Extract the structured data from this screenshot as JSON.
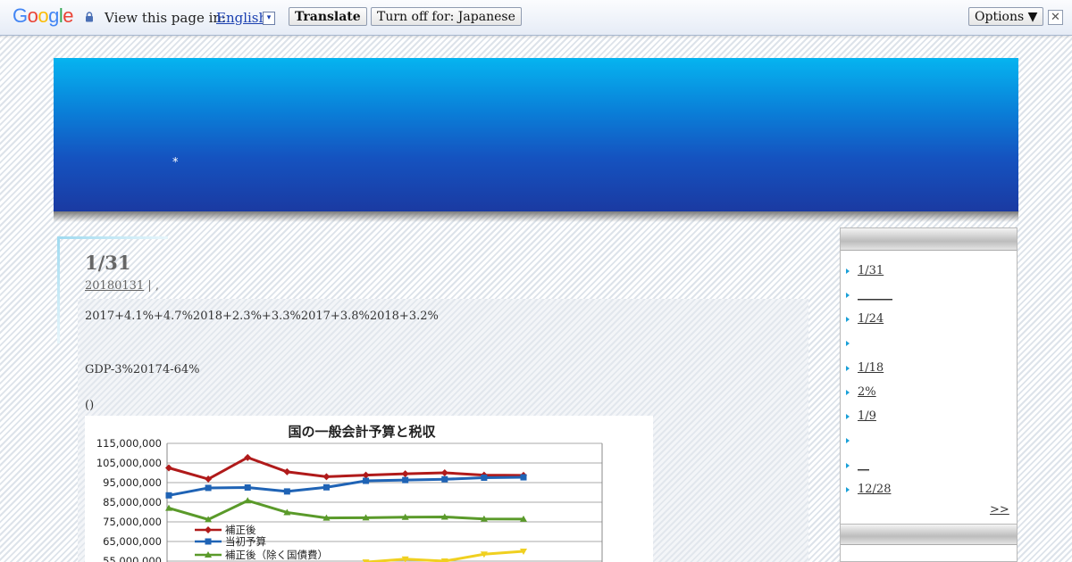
{
  "translate_bar": {
    "view_label": "View this page in:",
    "language": "English",
    "dropdown_glyph": "▾",
    "translate_label": "Translate",
    "turn_off_label": "Turn off for: Japanese",
    "options_label": "Options ▼",
    "close_glyph": "✕",
    "logo": [
      "G",
      "o",
      "o",
      "g",
      "l",
      "e"
    ],
    "logo_colors": [
      "#4285f4",
      "#ea4335",
      "#fbbc05",
      "#4285f4",
      "#34a853",
      "#ea4335"
    ]
  },
  "header": {
    "mark": "*"
  },
  "post": {
    "title": "1/31",
    "date_link": "20180131",
    "meta_suffix": " | ,",
    "paragraphs": [
      "2017+4.1%+4.7%2018+2.3%+3.3%2017+3.8%2018+3.2%",
      "GDP-3%20174-64%",
      "()"
    ]
  },
  "sidebar": {
    "items": [
      {
        "label": "1/31",
        "link": true
      },
      {
        "label": "______",
        "link": true
      },
      {
        "label": "1/24",
        "link": true
      },
      {
        "label": "",
        "link": false
      },
      {
        "label": "1/18",
        "link": true
      },
      {
        "label": "2%",
        "link": true
      },
      {
        "label": "1/9",
        "link": true
      },
      {
        "label": "",
        "link": false
      },
      {
        "label": "__",
        "link": true
      },
      {
        "label": "12/28",
        "link": true
      }
    ],
    "more": ">>",
    "second_widget_item": "(?)"
  },
  "chart_data": {
    "type": "line",
    "title": "国の一般会計予算と税収",
    "ylim": [
      55000000,
      115000000
    ],
    "yticks": [
      "115,000,000",
      "105,000,000",
      "95,000,000",
      "85,000,000",
      "75,000,000",
      "65,000,000",
      "55,000,000"
    ],
    "series": [
      {
        "name": "補正後",
        "color": "#b01a1a",
        "marker": "diamond",
        "values": [
          102500000,
          96800000,
          107800000,
          100500000,
          98000000,
          98800000,
          99500000,
          100000000,
          98800000,
          98700000
        ]
      },
      {
        "name": "当初予算",
        "color": "#1f63b5",
        "marker": "square",
        "values": [
          88500000,
          92300000,
          92500000,
          90500000,
          92600000,
          95900000,
          96300000,
          96700000,
          97500000,
          97700000
        ]
      },
      {
        "name": "補正後（除く国債費）",
        "color": "#5a9a2a",
        "marker": "triangle",
        "values": [
          82000000,
          76200000,
          85800000,
          79800000,
          77000000,
          77100000,
          77400000,
          77500000,
          76500000,
          76400000
        ]
      },
      {
        "name": "",
        "color": "#f0d020",
        "marker": "triangle-down",
        "values": [
          null,
          null,
          null,
          null,
          null,
          54500000,
          56000000,
          55000000,
          58500000,
          60000000
        ]
      }
    ]
  }
}
